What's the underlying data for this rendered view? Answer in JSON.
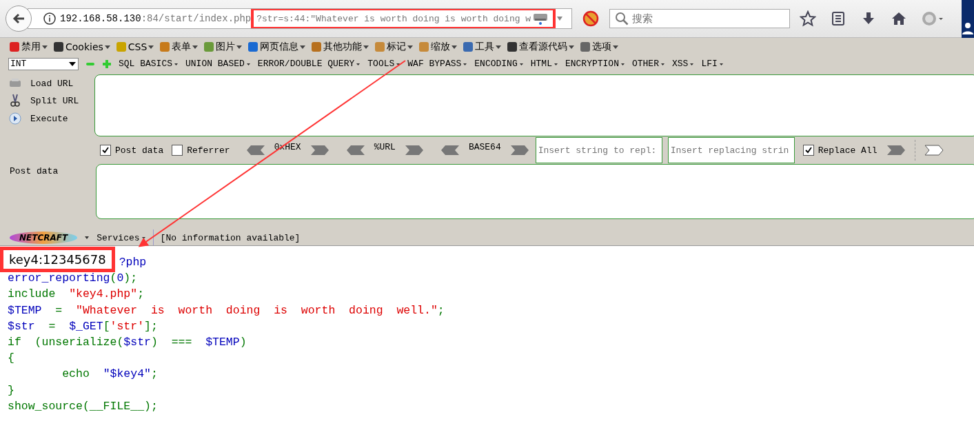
{
  "navbar": {
    "url_host": "192.168.58.130",
    "url_path": ":84/start/index.php",
    "url_query": "?str=s:44:\"Whatever is worth doing is worth doing w",
    "search_placeholder": "搜索"
  },
  "webdev_menu": [
    "禁用",
    "Cookies",
    "CSS",
    "表单",
    "图片",
    "网页信息",
    "其他功能",
    "标记",
    "缩放",
    "工具",
    "查看源代码",
    "选项"
  ],
  "hackbar": {
    "type_select": "INT",
    "menus": [
      "SQL BASICS",
      "UNION BASED",
      "ERROR/DOUBLE QUERY",
      "TOOLS",
      "WAF BYPASS",
      "ENCODING",
      "HTML",
      "ENCRYPTION",
      "OTHER",
      "XSS",
      "LFI"
    ],
    "actions": [
      "Load URL",
      "Split URL",
      "Execute"
    ],
    "options": [
      {
        "label": "Post data",
        "checked": true
      },
      {
        "label": "Referrer",
        "checked": false
      }
    ],
    "encoders": [
      "0xHEX",
      "%URL",
      "BASE64"
    ],
    "replace_from_placeholder": "Insert string to repl:",
    "replace_to_placeholder": "Insert replacing strin",
    "replace_all": {
      "label": "Replace All",
      "checked": true
    },
    "post_data_label": "Post data"
  },
  "netcraft": {
    "logo": "NETCRAFT",
    "services": "Services",
    "info": "[No information available]"
  },
  "page": {
    "output": "key4:12345678",
    "code": [
      [
        {
          "text": "?php",
          "kind": "default"
        }
      ],
      [
        {
          "text": "error_reporting",
          "kind": "default"
        },
        {
          "text": "(",
          "kind": "keyword"
        },
        {
          "text": "0",
          "kind": "default"
        },
        {
          "text": ");",
          "kind": "keyword"
        }
      ],
      [
        {
          "text": "include  ",
          "kind": "keyword"
        },
        {
          "text": "\"key4.php\"",
          "kind": "string"
        },
        {
          "text": ";",
          "kind": "keyword"
        }
      ],
      [
        {
          "text": "$TEMP  ",
          "kind": "default"
        },
        {
          "text": "=  ",
          "kind": "keyword"
        },
        {
          "text": "\"Whatever  is  worth  doing  is  worth  doing  well.\"",
          "kind": "string"
        },
        {
          "text": ";",
          "kind": "keyword"
        }
      ],
      [
        {
          "text": "$str  ",
          "kind": "default"
        },
        {
          "text": "=  ",
          "kind": "keyword"
        },
        {
          "text": "$_GET",
          "kind": "default"
        },
        {
          "text": "[",
          "kind": "keyword"
        },
        {
          "text": "'str'",
          "kind": "string"
        },
        {
          "text": "];",
          "kind": "keyword"
        }
      ],
      [
        {
          "text": "if  (unserialize(",
          "kind": "keyword"
        },
        {
          "text": "$str",
          "kind": "default"
        },
        {
          "text": ")  ===  ",
          "kind": "keyword"
        },
        {
          "text": "$TEMP",
          "kind": "default"
        },
        {
          "text": ")",
          "kind": "keyword"
        }
      ],
      [
        {
          "text": "{",
          "kind": "keyword"
        }
      ],
      [
        {
          "text": "        echo  ",
          "kind": "keyword"
        },
        {
          "text": "\"$key4\"",
          "kind": "default"
        },
        {
          "text": ";",
          "kind": "keyword"
        }
      ],
      [
        {
          "text": "}",
          "kind": "keyword"
        }
      ],
      [
        {
          "text": "show_source(__FILE__);",
          "kind": "keyword"
        }
      ]
    ]
  }
}
